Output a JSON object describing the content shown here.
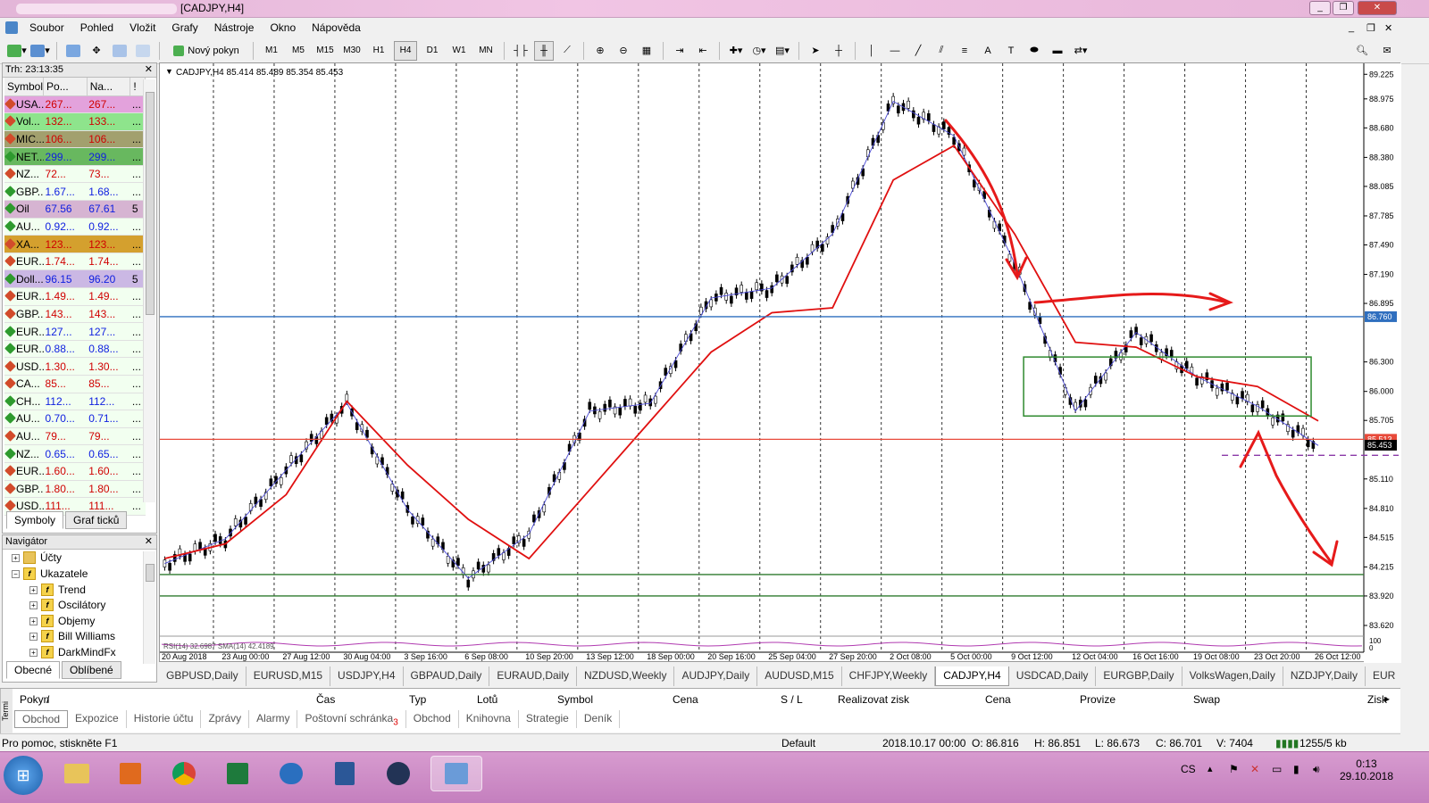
{
  "window": {
    "title": "[CADJPY,H4]"
  },
  "menu": [
    "Soubor",
    "Pohled",
    "Vložit",
    "Grafy",
    "Nástroje",
    "Okno",
    "Nápověda"
  ],
  "toolbar": {
    "new_order": "Nový pokyn",
    "timeframes": [
      "M1",
      "M5",
      "M15",
      "M30",
      "H1",
      "H4",
      "D1",
      "W1",
      "MN"
    ],
    "selected_tf": "H4"
  },
  "market_watch": {
    "time": "Trh: 23:13:35",
    "columns": [
      "Symbol",
      "Po...",
      "Na...",
      "!"
    ],
    "rows": [
      {
        "s": "USA...",
        "b": "267...",
        "a": "267...",
        "x": "...",
        "bg": "#e3a2dc",
        "c": "#d00000",
        "up": false
      },
      {
        "s": "Vol...",
        "b": "132...",
        "a": "133...",
        "x": "...",
        "bg": "#8ee48c",
        "c": "#d00000",
        "up": false
      },
      {
        "s": "MIC...",
        "b": "106...",
        "a": "106...",
        "x": "...",
        "bg": "#a2a06e",
        "c": "#d00000",
        "up": false
      },
      {
        "s": "NET...",
        "b": "299...",
        "a": "299...",
        "x": "...",
        "bg": "#68b85f",
        "c": "#1020e0",
        "up": true
      },
      {
        "s": "NZ...",
        "b": "72...",
        "a": "73...",
        "x": "...",
        "bg": "#f2fff0",
        "c": "#d00000",
        "up": false
      },
      {
        "s": "GBP...",
        "b": "1.67...",
        "a": "1.68...",
        "x": "...",
        "bg": "#f2fff0",
        "c": "#1020e0",
        "up": true
      },
      {
        "s": "Oil",
        "b": "67.56",
        "a": "67.61",
        "x": "5",
        "bg": "#d6b4d2",
        "c": "#1020e0",
        "up": true
      },
      {
        "s": "AU...",
        "b": "0.92...",
        "a": "0.92...",
        "x": "...",
        "bg": "#f2fff0",
        "c": "#1020e0",
        "up": true
      },
      {
        "s": "XA...",
        "b": "123...",
        "a": "123...",
        "x": "...",
        "bg": "#d4a02e",
        "c": "#d00000",
        "up": false
      },
      {
        "s": "EUR...",
        "b": "1.74...",
        "a": "1.74...",
        "x": "...",
        "bg": "#f2fff0",
        "c": "#d00000",
        "up": false
      },
      {
        "s": "Doll...",
        "b": "96.15",
        "a": "96.20",
        "x": "5",
        "bg": "#cbb8e4",
        "c": "#1020e0",
        "up": true
      },
      {
        "s": "EUR...",
        "b": "1.49...",
        "a": "1.49...",
        "x": "...",
        "bg": "#f2fff0",
        "c": "#d00000",
        "up": false
      },
      {
        "s": "GBP...",
        "b": "143...",
        "a": "143...",
        "x": "...",
        "bg": "#f2fff0",
        "c": "#d00000",
        "up": false
      },
      {
        "s": "EUR...",
        "b": "127...",
        "a": "127...",
        "x": "...",
        "bg": "#f2fff0",
        "c": "#1020e0",
        "up": true
      },
      {
        "s": "EUR...",
        "b": "0.88...",
        "a": "0.88...",
        "x": "...",
        "bg": "#f2fff0",
        "c": "#1020e0",
        "up": true
      },
      {
        "s": "USD...",
        "b": "1.30...",
        "a": "1.30...",
        "x": "...",
        "bg": "#f2fff0",
        "c": "#d00000",
        "up": false
      },
      {
        "s": "CA...",
        "b": "85...",
        "a": "85...",
        "x": "...",
        "bg": "#f2fff0",
        "c": "#d00000",
        "up": false
      },
      {
        "s": "CH...",
        "b": "112...",
        "a": "112...",
        "x": "...",
        "bg": "#f2fff0",
        "c": "#1020e0",
        "up": true
      },
      {
        "s": "AU...",
        "b": "0.70...",
        "a": "0.71...",
        "x": "...",
        "bg": "#f2fff0",
        "c": "#1020e0",
        "up": true
      },
      {
        "s": "AU...",
        "b": "79...",
        "a": "79...",
        "x": "...",
        "bg": "#f2fff0",
        "c": "#d00000",
        "up": false
      },
      {
        "s": "NZ...",
        "b": "0.65...",
        "a": "0.65...",
        "x": "...",
        "bg": "#f2fff0",
        "c": "#1020e0",
        "up": true
      },
      {
        "s": "EUR...",
        "b": "1.60...",
        "a": "1.60...",
        "x": "...",
        "bg": "#f2fff0",
        "c": "#d00000",
        "up": false
      },
      {
        "s": "GBP...",
        "b": "1.80...",
        "a": "1.80...",
        "x": "...",
        "bg": "#f2fff0",
        "c": "#d00000",
        "up": false
      },
      {
        "s": "USD...",
        "b": "111...",
        "a": "111...",
        "x": "...",
        "bg": "#f2fff0",
        "c": "#d00000",
        "up": false
      }
    ],
    "tabs": [
      "Symboly",
      "Graf ticků"
    ]
  },
  "navigator": {
    "title": "Navigátor",
    "items": [
      "Účty",
      "Ukazatele",
      "Trend",
      "Oscilátory",
      "Objemy",
      "Bill Williams",
      "DarkMindFx"
    ],
    "tabs": [
      "Obecné",
      "Oblíbené"
    ]
  },
  "chart": {
    "header": "CADJPY,H4  85.414 85.489 85.354 85.453",
    "indicator_label": "RSI(14) 32.6987  SMA(14) 42.4189",
    "price_ticks": [
      "89.225",
      "88.975",
      "88.680",
      "88.380",
      "88.085",
      "87.785",
      "87.490",
      "87.190",
      "86.895",
      "86.300",
      "86.000",
      "85.705",
      "85.110",
      "84.810",
      "84.515",
      "84.215",
      "83.920",
      "83.620"
    ],
    "price_label_hline": "86.760",
    "price_label_red": "85.513",
    "price_label_current": "85.453",
    "ind_ticks": [
      "100",
      "0"
    ],
    "date_ticks": [
      "20 Aug 2018",
      "23 Aug 00:00",
      "27 Aug 12:00",
      "30 Aug 04:00",
      "3 Sep 16:00",
      "6 Sep 08:00",
      "10 Sep 20:00",
      "13 Sep 12:00",
      "18 Sep 00:00",
      "20 Sep 16:00",
      "25 Sep 04:00",
      "27 Sep 20:00",
      "2 Oct 08:00",
      "5 Oct 00:00",
      "9 Oct 12:00",
      "12 Oct 04:00",
      "16 Oct 16:00",
      "19 Oct 08:00",
      "23 Oct 20:00",
      "26 Oct 12:00"
    ]
  },
  "chart_data": {
    "type": "line",
    "title": "CADJPY,H4",
    "xlabel": "",
    "ylabel": "",
    "ylim": [
      83.62,
      89.3
    ],
    "x": [
      "20 Aug 2018",
      "23 Aug 00:00",
      "27 Aug 12:00",
      "30 Aug 04:00",
      "3 Sep 16:00",
      "6 Sep 08:00",
      "10 Sep 20:00",
      "13 Sep 12:00",
      "18 Sep 00:00",
      "20 Sep 16:00",
      "25 Sep 04:00",
      "27 Sep 20:00",
      "2 Oct 08:00",
      "5 Oct 00:00",
      "9 Oct 12:00",
      "12 Oct 04:00",
      "16 Oct 16:00",
      "19 Oct 08:00",
      "23 Oct 20:00",
      "26 Oct 12:00"
    ],
    "series": [
      {
        "name": "",
        "values": [
          84.25,
          84.5,
          85.2,
          85.88,
          84.8,
          84.1,
          84.55,
          85.8,
          85.88,
          86.95,
          87.05,
          87.6,
          88.95,
          88.6,
          87.3,
          85.8,
          86.6,
          86.15,
          85.85,
          85.45
        ]
      },
      {
        "name": "",
        "values": [
          84.3,
          84.45,
          84.95,
          85.9,
          85.25,
          84.7,
          84.3,
          85.0,
          85.7,
          86.4,
          86.8,
          86.85,
          88.15,
          88.5,
          87.6,
          86.5,
          86.45,
          86.15,
          86.05,
          85.7
        ]
      }
    ],
    "hlines": [
      86.76,
      85.513,
      83.92
    ],
    "box": [
      86.35,
      85.75
    ]
  },
  "chart_tabs": [
    "GBPUSD,Daily",
    "EURUSD,M15",
    "USDJPY,H4",
    "GBPAUD,Daily",
    "EURAUD,Daily",
    "NZDUSD,Weekly",
    "AUDJPY,Daily",
    "AUDUSD,M15",
    "CHFJPY,Weekly",
    "CADJPY,H4",
    "USDCAD,Daily",
    "EURGBP,Daily",
    "VolksWagen,Daily",
    "NZDJPY,Daily",
    "EUR"
  ],
  "active_chart_tab": "CADJPY,H4",
  "terminal": {
    "columns": [
      "Pokyn",
      "/",
      "Čas",
      "Typ",
      "Lotů",
      "Symbol",
      "Cena",
      "S / L",
      "Realizovat zisk",
      "Cena",
      "Provize",
      "Swap",
      "Zisk"
    ],
    "tabs": [
      "Obchod",
      "Expozice",
      "Historie účtu",
      "Zprávy",
      "Alarmy",
      "Poštovní schránka",
      "Obchod",
      "Knihovna",
      "Strategie",
      "Deník"
    ],
    "side": "Termi",
    "mail_badge": "3"
  },
  "status": {
    "help": "Pro pomoc, stiskněte F1",
    "profile": "Default",
    "time": "2018.10.17 00:00",
    "o": "O: 86.816",
    "h": "H: 86.851",
    "l": "L: 86.673",
    "c": "C: 86.701",
    "v": "V: 7404",
    "traffic": "1255/5 kb"
  },
  "taskbar": {
    "lang": "CS",
    "time": "0:13",
    "date": "29.10.2018"
  }
}
